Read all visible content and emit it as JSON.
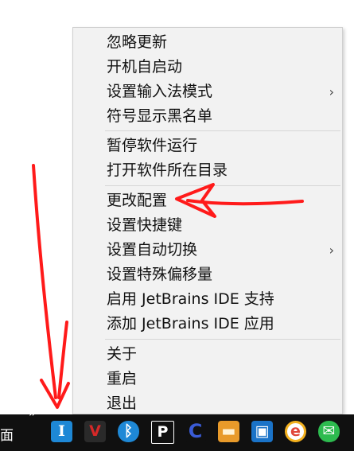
{
  "menu": {
    "items": [
      {
        "label": "忽略更新"
      },
      {
        "label": "开机自启动"
      },
      {
        "label": "设置输入法模式",
        "submenu": "›"
      },
      {
        "label": "符号显示黑名单"
      },
      {
        "label": "暂停软件运行"
      },
      {
        "label": "打开软件所在目录"
      },
      {
        "label": "更改配置"
      },
      {
        "label": "设置快捷键"
      },
      {
        "label": "设置自动切换",
        "submenu": "›"
      },
      {
        "label": "设置特殊偏移量"
      },
      {
        "label": "启用 JetBrains IDE 支持"
      },
      {
        "label": "添加 JetBrains IDE 应用"
      },
      {
        "label": "关于"
      },
      {
        "label": "重启"
      },
      {
        "label": "退出"
      }
    ]
  },
  "taskbar": {
    "left_text": "面",
    "overflow": "»",
    "icons": [
      {
        "name": "input-method-icon",
        "glyph": "I",
        "color": "#1e88d6"
      },
      {
        "name": "vector-app-icon",
        "glyph": "V",
        "color": "#d62828"
      },
      {
        "name": "bluetooth-icon",
        "glyph": "ᛒ",
        "color": "#1e88d6"
      },
      {
        "name": "pixpin-icon",
        "glyph": "P",
        "color": "#101010"
      },
      {
        "name": "sync-icon",
        "glyph": "C",
        "color": "#3a5bd6"
      },
      {
        "name": "window-app-icon",
        "glyph": "▬",
        "color": "#e89a2a"
      },
      {
        "name": "network-app-icon",
        "glyph": "▣",
        "color": "#1a73c8"
      },
      {
        "name": "chrome-icon",
        "glyph": "e",
        "color": "#e0463a"
      },
      {
        "name": "wechat-icon",
        "glyph": "✉",
        "color": "#2dbb4f"
      }
    ]
  },
  "colors": {
    "arrow": "#ff1a1a",
    "menu_bg": "#f2f2f2",
    "taskbar_bg": "#101010"
  }
}
